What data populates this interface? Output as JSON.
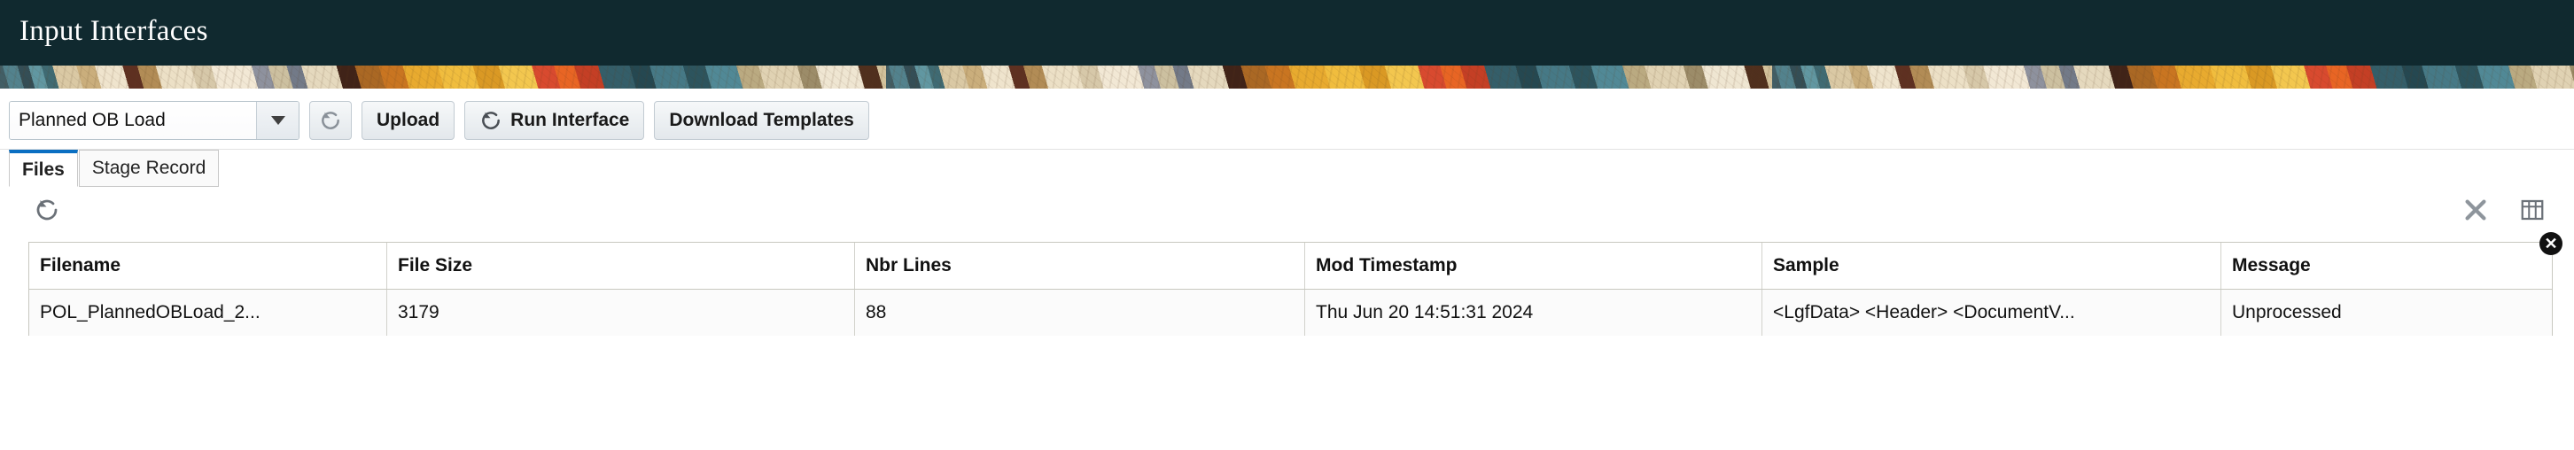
{
  "header": {
    "title": "Input Interfaces",
    "background": "#10292f"
  },
  "toolbar": {
    "interface_select": {
      "value": "Planned OB Load",
      "icon": "chevron-down-icon"
    },
    "refresh_button": {
      "icon": "refresh-icon",
      "label": ""
    },
    "upload_button": {
      "label": "Upload"
    },
    "run_interface_button": {
      "label": "Run Interface",
      "icon": "refresh-icon"
    },
    "download_templates_button": {
      "label": "Download Templates"
    }
  },
  "tabs": [
    {
      "label": "Files",
      "active": true
    },
    {
      "label": "Stage Record",
      "active": false
    }
  ],
  "panel_toolbar": {
    "refresh": {
      "icon": "refresh-icon"
    },
    "detach": {
      "icon": "close-x-icon"
    },
    "columns": {
      "icon": "table-columns-icon"
    }
  },
  "table": {
    "columns": [
      "Filename",
      "File Size",
      "Nbr Lines",
      "Mod Timestamp",
      "Sample",
      "Message"
    ],
    "rows": [
      {
        "filename": "POL_PlannedOBLoad_2...",
        "file_size": "3179",
        "nbr_lines": "88",
        "mod_timestamp": "Thu Jun 20 14:51:31 2024",
        "sample": "<LgfData> <Header> <DocumentV...",
        "message": "Unprocessed"
      }
    ],
    "close_badge": "✕"
  },
  "colors": {
    "header_bg": "#10292f",
    "active_tab_accent": "#0a6fc2",
    "button_text": "#1a1a1a"
  }
}
